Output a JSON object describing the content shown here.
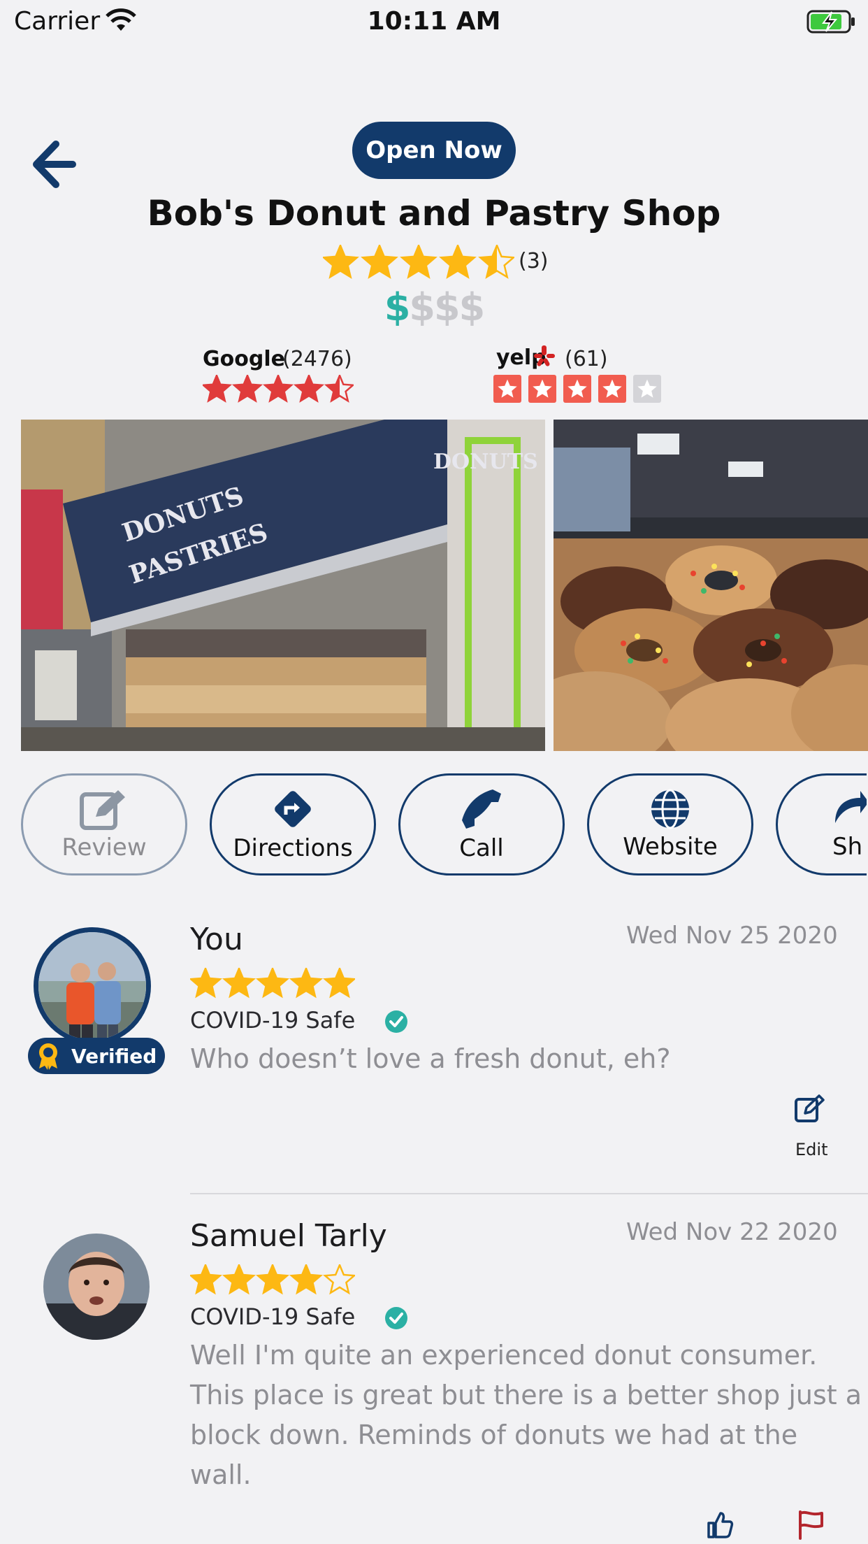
{
  "status_bar": {
    "carrier": "Carrier",
    "time": "10:11 AM"
  },
  "header": {
    "open_badge": "Open Now",
    "title": "Bob's Donut and Pastry Shop",
    "rating": 4.5,
    "rating_count": "(3)",
    "price": {
      "active": "$",
      "inactive": "$$$"
    }
  },
  "external_ratings": {
    "google": {
      "label": "Google",
      "count": "(2476)",
      "rating": 4.5,
      "star_color": "#e03b3b"
    },
    "yelp": {
      "label": "yelp",
      "count": "(61)",
      "rating": 4,
      "star_color": "#f15c4f"
    }
  },
  "actions": [
    {
      "label": "Review",
      "icon": "edit-icon",
      "disabled": true
    },
    {
      "label": "Directions",
      "icon": "directions-icon"
    },
    {
      "label": "Call",
      "icon": "phone-icon"
    },
    {
      "label": "Website",
      "icon": "globe-icon"
    },
    {
      "label": "Sh",
      "icon": "share-icon"
    }
  ],
  "reviews": [
    {
      "name": "You",
      "date": "Wed Nov 25 2020",
      "rating": 5,
      "covid": "COVID-19 Safe",
      "text": "Who doesn’t love a fresh donut, eh?",
      "badge": "Verified",
      "edit_label": "Edit"
    },
    {
      "name": "Samuel Tarly",
      "date": "Wed Nov 22 2020",
      "rating": 4,
      "covid": "COVID-19 Safe",
      "text_lines": [
        "Well I'm quite an experienced donut consumer.",
        "This place is great but there is a better shop just a",
        "block down. Reminds of donuts we had at the",
        "wall."
      ]
    }
  ],
  "colors": {
    "navy": "#123a6b",
    "star_gold": "#fdb813",
    "teal": "#2bb0a4"
  }
}
